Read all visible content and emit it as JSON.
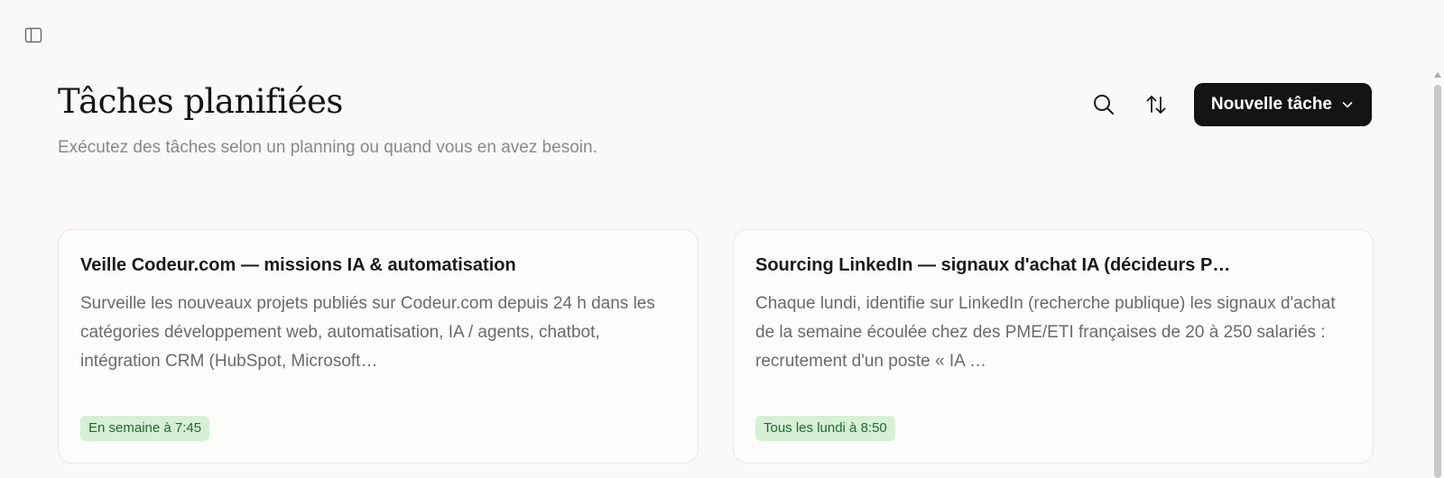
{
  "sidebar_toggle": {
    "icon": "sidebar-panel-icon"
  },
  "header": {
    "title": "Tâches planifiées",
    "subtitle": "Exécutez des tâches selon un planning ou quand vous en avez besoin."
  },
  "actions": {
    "search_icon": "search-icon",
    "sort_icon": "sort-arrows-icon",
    "new_task_label": "Nouvelle tâche"
  },
  "tasks": [
    {
      "title": "Veille Codeur.com — missions IA & automatisation",
      "description": "Surveille les nouveaux projets publiés sur Codeur.com depuis 24 h dans les catégories développement web, automatisation, IA / agents, chatbot, intégration CRM (HubSpot, Microsoft…",
      "schedule": "En semaine à 7:45"
    },
    {
      "title": "Sourcing LinkedIn — signaux d'achat IA (décideurs P…",
      "description": "Chaque lundi, identifie sur LinkedIn (recherche publique) les signaux d'achat de la semaine écoulée chez des PME/ETI françaises de 20 à 250 salariés : recrutement d'un poste « IA …",
      "schedule": "Tous les lundi à 8:50"
    }
  ],
  "colors": {
    "background": "#faf9f7",
    "primary_button": "#141413",
    "badge_bg": "#d5f0d5",
    "badge_text": "#1f6b2a"
  }
}
